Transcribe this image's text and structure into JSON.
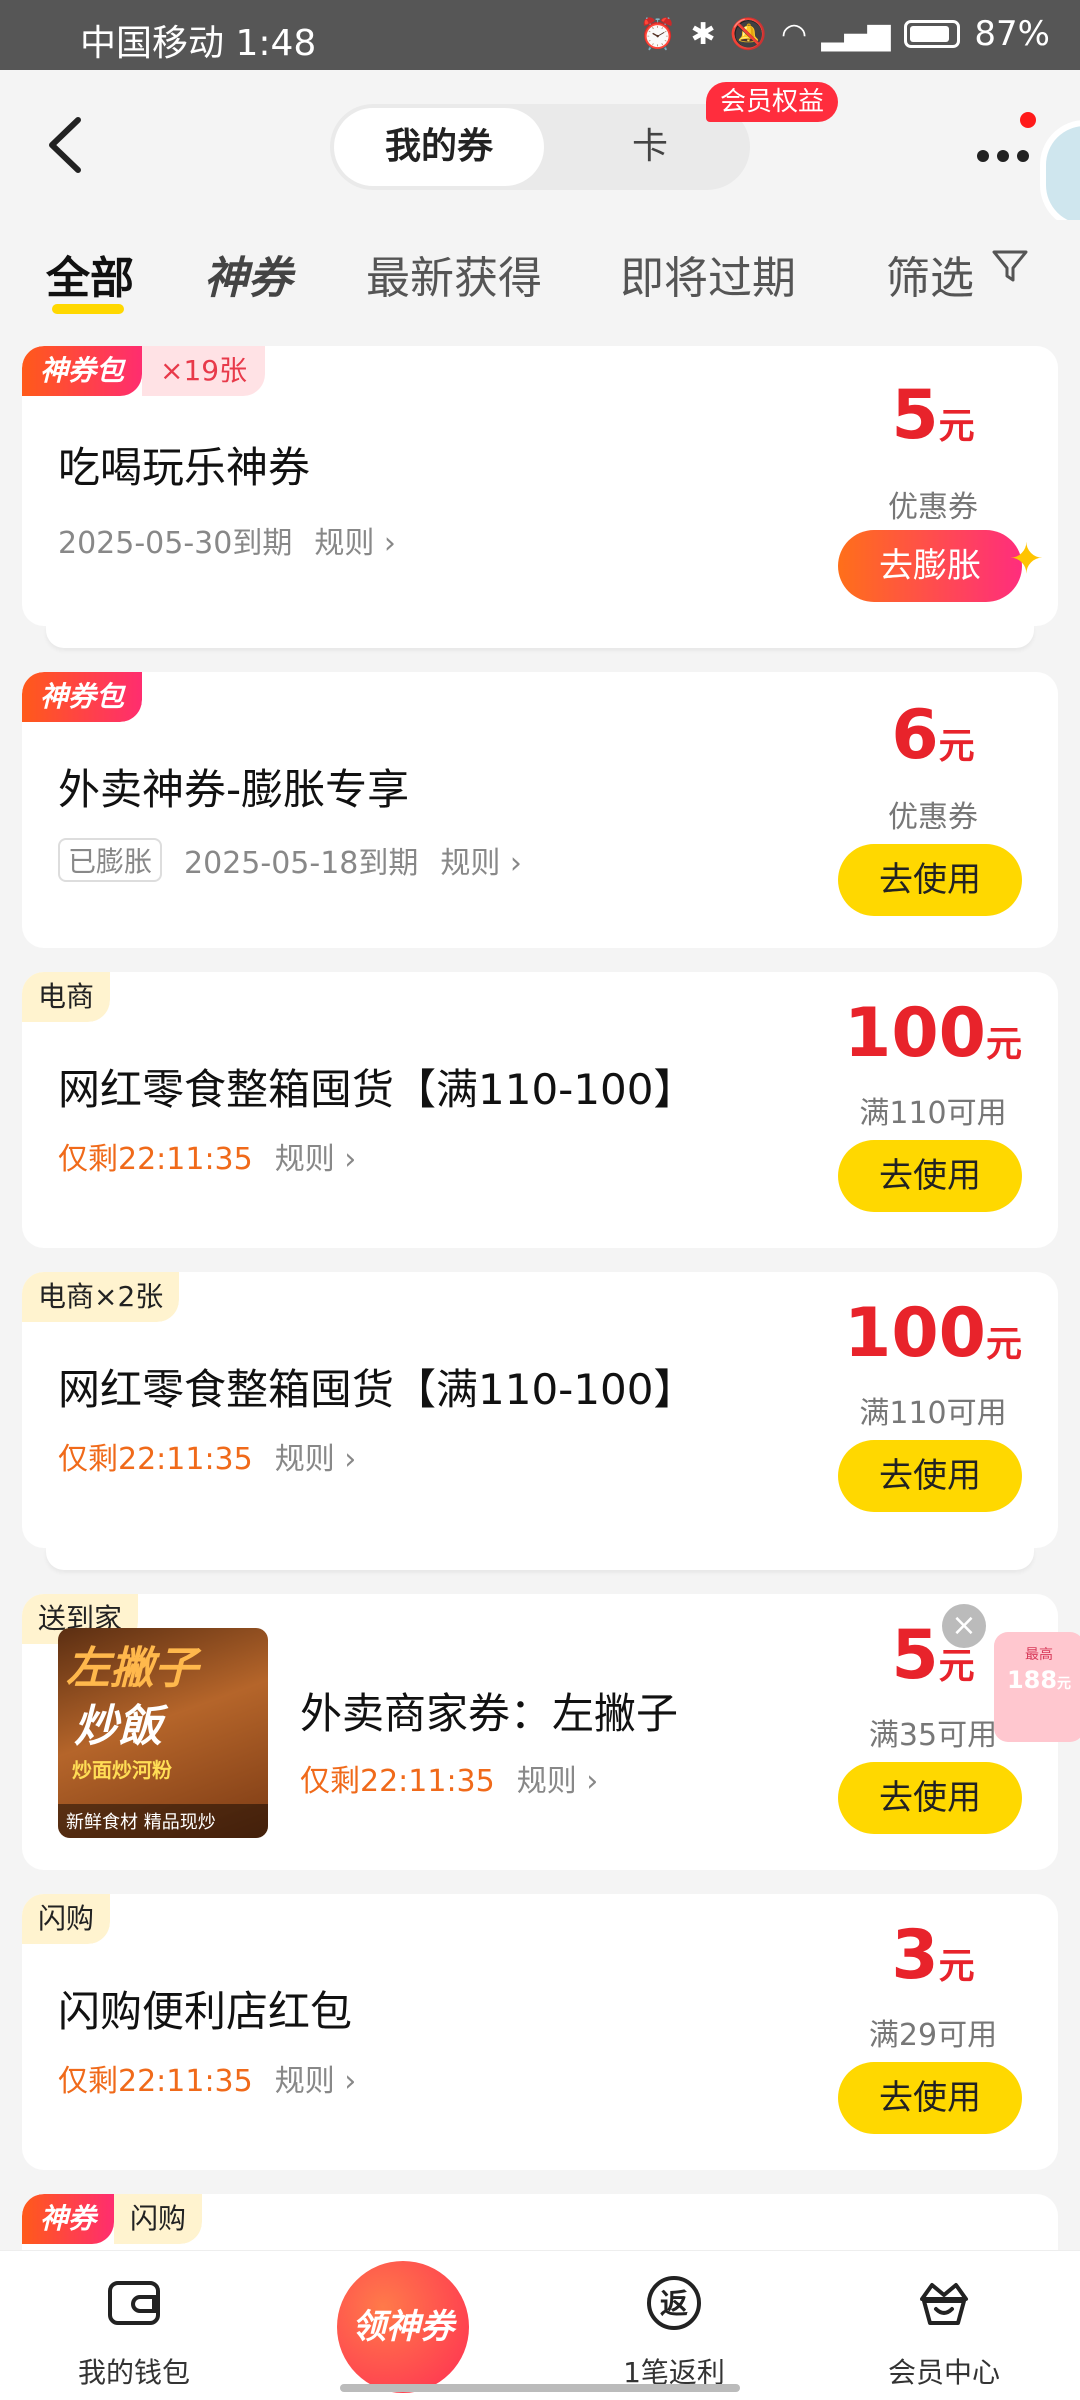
{
  "status_bar": {
    "carrier_time": "中国移动 1:48",
    "battery": "87%",
    "battery_level": 0.87
  },
  "header": {
    "back_icon": "back-arrow-icon",
    "tabs": [
      "我的券",
      "卡"
    ],
    "member_badge": "会员权益",
    "more_icon": "more-dots-icon"
  },
  "filter_tabs": {
    "items": [
      "全部",
      "神券",
      "最新获得",
      "即将过期",
      "筛选"
    ],
    "active_index": 0
  },
  "coupons": [
    {
      "tags": [
        "神券包",
        "×19张"
      ],
      "title": "吃喝玩乐神券",
      "expiry": "2025-05-30到期",
      "rule": "规则",
      "amount": "5",
      "unit": "元",
      "condition": "优惠券",
      "button": "去膨胀"
    },
    {
      "tags": [
        "神券包"
      ],
      "title": "外卖神券-膨胀专享",
      "status": "已膨胀",
      "expiry": "2025-05-18到期",
      "rule": "规则",
      "amount": "6",
      "unit": "元",
      "condition": "优惠券",
      "button": "去使用"
    },
    {
      "tags": [
        "电商"
      ],
      "title": "网红零食整箱囤货【满110-100】",
      "countdown": "仅剩22:11:35",
      "rule": "规则",
      "amount": "100",
      "unit": "元",
      "condition": "满110可用",
      "button": "去使用"
    },
    {
      "tags": [
        "电商×2张"
      ],
      "title": "网红零食整箱囤货【满110-100】",
      "countdown": "仅剩22:11:35",
      "rule": "规则",
      "amount": "100",
      "unit": "元",
      "condition": "满110可用",
      "button": "去使用"
    },
    {
      "tags": [
        "送到家"
      ],
      "title": "外卖商家券：左撇子",
      "countdown": "仅剩22:11:35",
      "rule": "规则",
      "amount": "5",
      "unit": "元",
      "condition": "满35可用",
      "button": "去使用",
      "thumb": {
        "line1": "左撇子",
        "line2": "炒飯",
        "line3": "炒面炒河粉",
        "line4": "新鲜食材 精品现炒"
      }
    },
    {
      "tags": [
        "闪购"
      ],
      "title": "闪购便利店红包",
      "countdown": "仅剩22:11:35",
      "rule": "规则",
      "amount": "3",
      "unit": "元",
      "condition": "满29可用",
      "button": "去使用"
    },
    {
      "tags": [
        "神券",
        "闪购"
      ]
    }
  ],
  "floating_widget": {
    "small_text": "最高",
    "amount": "188",
    "unit": "元"
  },
  "bottom_nav": {
    "items": [
      "我的钱包",
      "领神券",
      "1笔返利",
      "会员中心"
    ],
    "rebate_icon_text": "返"
  },
  "colors": {
    "accent_yellow": "#ffd800",
    "price_red": "#e8232b",
    "countdown_orange": "#f06a1a",
    "badge_red": "#ff2d3d"
  }
}
